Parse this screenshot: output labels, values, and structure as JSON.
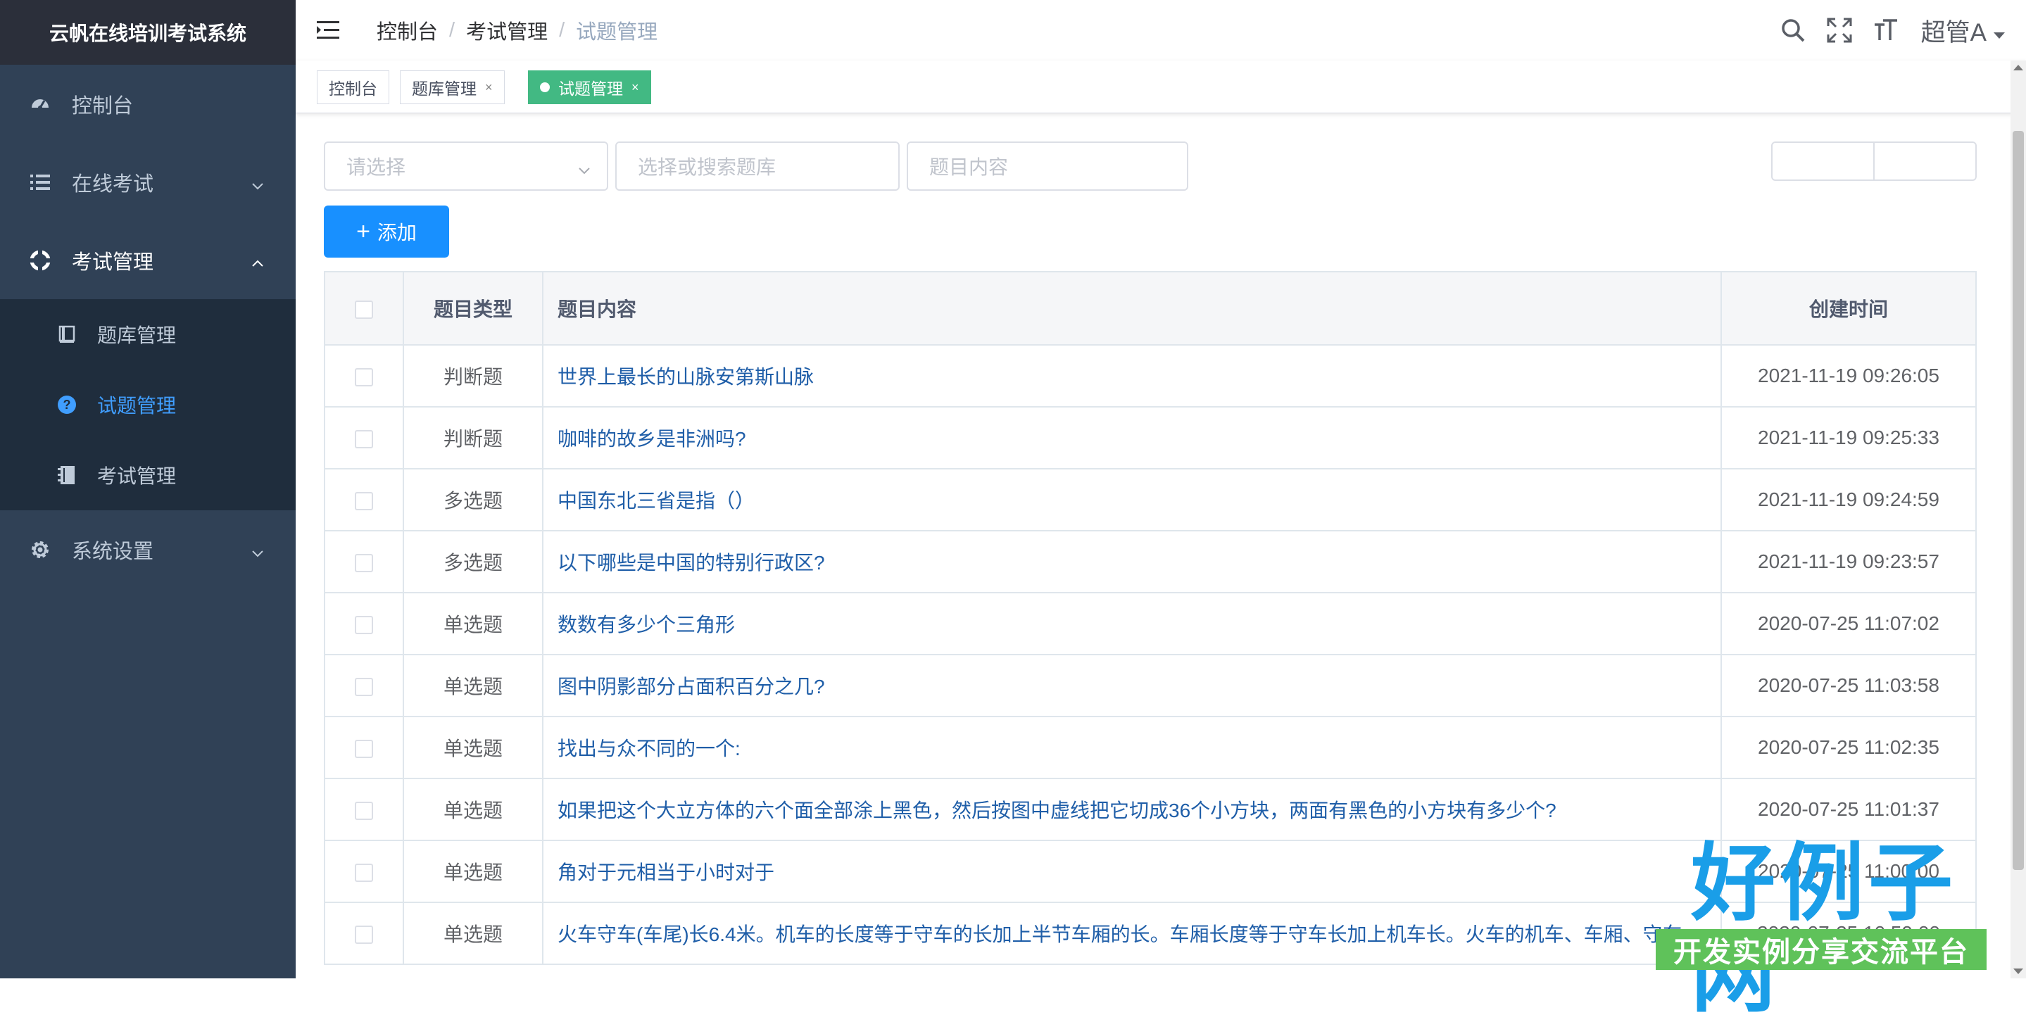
{
  "app": {
    "title": "云帆在线培训考试系统"
  },
  "sidebar": {
    "items": [
      {
        "label": "控制台",
        "icon": "dashboard-icon"
      },
      {
        "label": "在线考试",
        "icon": "list-icon"
      },
      {
        "label": "考试管理",
        "icon": "component-icon",
        "expanded": true
      },
      {
        "label": "系统设置",
        "icon": "gear-icon"
      }
    ],
    "submenu": [
      {
        "label": "题库管理",
        "icon": "book-icon"
      },
      {
        "label": "试题管理",
        "icon": "question-icon",
        "active": true
      },
      {
        "label": "考试管理",
        "icon": "exam-icon"
      }
    ]
  },
  "navbar": {
    "breadcrumb": [
      "控制台",
      "考试管理",
      "试题管理"
    ],
    "separator": "/",
    "username": "超管A"
  },
  "tags": [
    {
      "label": "控制台"
    },
    {
      "label": "题库管理",
      "close": "×"
    },
    {
      "label": "试题管理",
      "close": "×",
      "active": true
    }
  ],
  "filters": {
    "type_placeholder": "请选择",
    "repo_placeholder": "选择或搜索题库",
    "content_placeholder": "题目内容"
  },
  "toolbar": {
    "add_label": "添加",
    "add_icon": "+"
  },
  "table": {
    "headers": {
      "type": "题目类型",
      "content": "题目内容",
      "time": "创建时间"
    },
    "rows": [
      {
        "type": "判断题",
        "content": "世界上最长的山脉安第斯山脉",
        "time": "2021-11-19 09:26:05"
      },
      {
        "type": "判断题",
        "content": "咖啡的故乡是非洲吗?",
        "time": "2021-11-19 09:25:33"
      },
      {
        "type": "多选题",
        "content": "中国东北三省是指（）",
        "time": "2021-11-19 09:24:59"
      },
      {
        "type": "多选题",
        "content": "以下哪些是中国的特别行政区?",
        "time": "2021-11-19 09:23:57"
      },
      {
        "type": "单选题",
        "content": "数数有多少个三角形",
        "time": "2020-07-25 11:07:02"
      },
      {
        "type": "单选题",
        "content": "图中阴影部分占面积百分之几?",
        "time": "2020-07-25 11:03:58"
      },
      {
        "type": "单选题",
        "content": "找出与众不同的一个:",
        "time": "2020-07-25 11:02:35"
      },
      {
        "type": "单选题",
        "content": "如果把这个大立方体的六个面全部涂上黑色，然后按图中虚线把它切成36个小方块，两面有黑色的小方块有多少个?",
        "time": "2020-07-25 11:01:37"
      },
      {
        "type": "单选题",
        "content": "角对于元相当于小时对于",
        "time": "2020-07-25 11:00:00"
      },
      {
        "type": "单选题",
        "content": "火车守车(车尾)长6.4米。机车的长度等于守车的长加上半节车厢的长。车厢长度等于守车长加上机车长。火车的机车、车厢、守车",
        "time": "2020-07-25 10:59:00"
      }
    ]
  },
  "watermark": {
    "main": "好例子网",
    "sub": "开发实例分享交流平台"
  },
  "colors": {
    "sidebar": "#304156",
    "accent": "#1890ff",
    "active_tag": "#42b983",
    "active_menu": "#409eff"
  }
}
